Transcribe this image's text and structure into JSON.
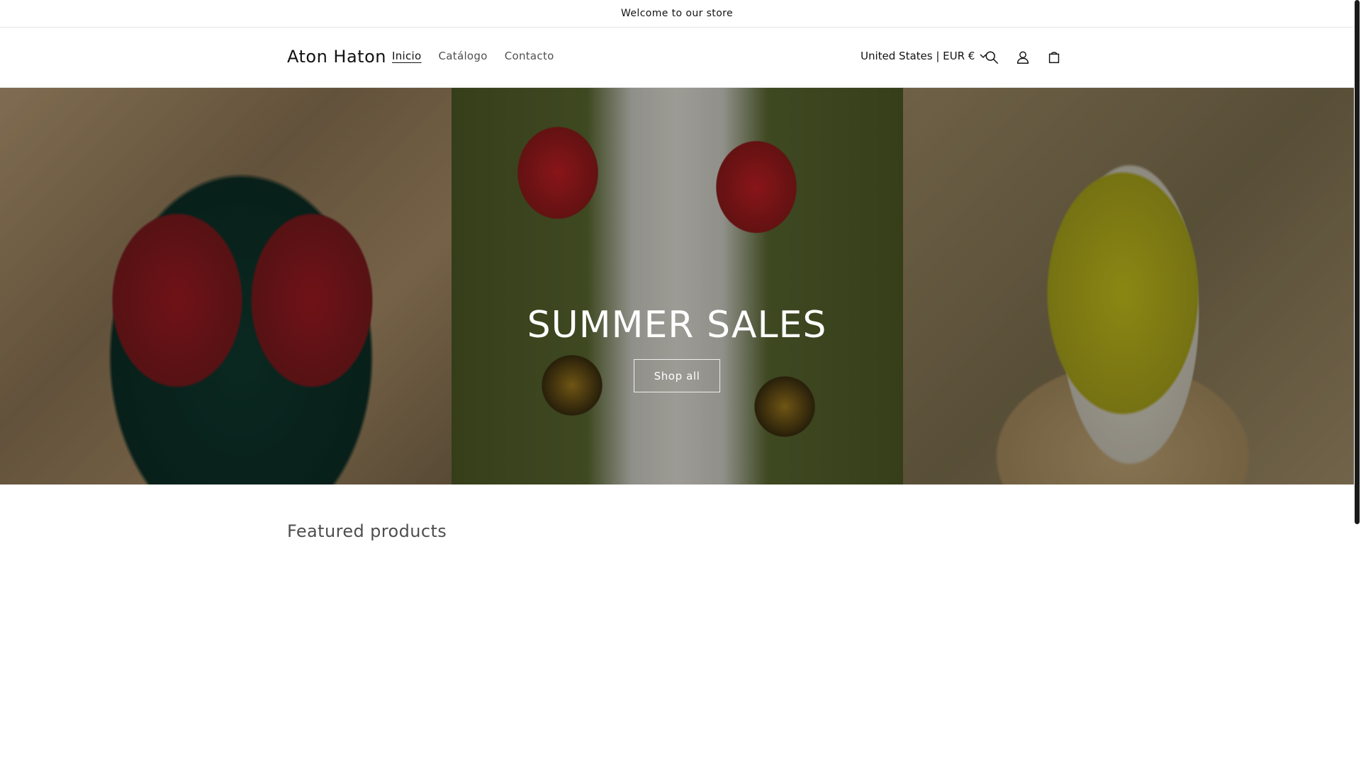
{
  "announcement": {
    "text": "Welcome to our store"
  },
  "header": {
    "logo": "Aton Haton",
    "nav": [
      {
        "label": "Inicio",
        "active": true
      },
      {
        "label": "Catálogo",
        "active": false
      },
      {
        "label": "Contacto",
        "active": false
      }
    ],
    "localization": "United States | EUR €",
    "icons": [
      "search-icon",
      "account-icon",
      "cart-icon"
    ]
  },
  "hero": {
    "title": "SUMMER SALES",
    "button_label": "Shop all"
  },
  "featured": {
    "title": "Featured products"
  },
  "colors": {
    "text": "#121212",
    "muted_text": "#5a5a5a",
    "hero_text": "#ffffff",
    "border": "#e6e6e6"
  }
}
